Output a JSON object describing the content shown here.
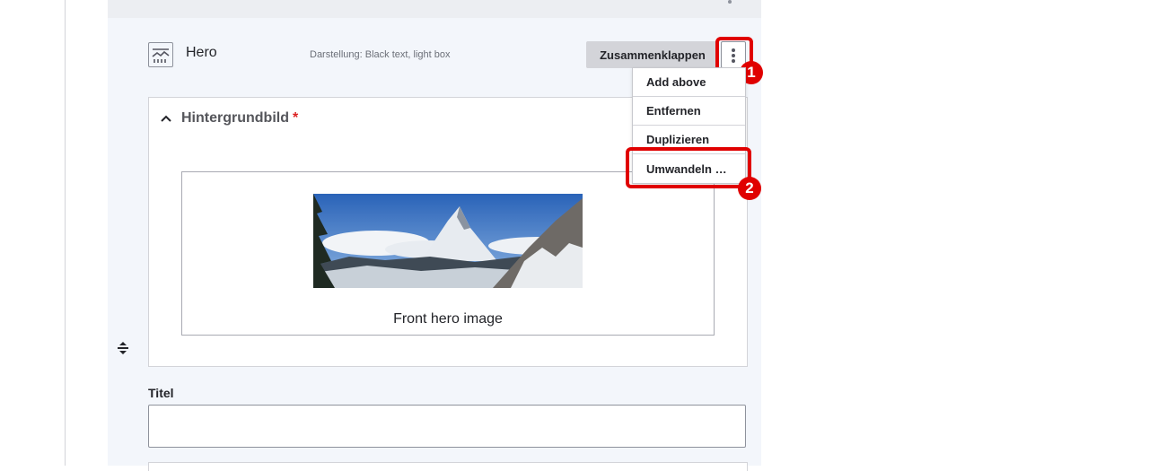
{
  "paragraph": {
    "title": "Hero",
    "summary": "Darstellung: Black text, light box",
    "collapse_label": "Zusammenklappen",
    "icon": "hero-paragraph-icon"
  },
  "actions_menu": {
    "icon": "kebab-menu-icon",
    "items": [
      {
        "label": "Add above"
      },
      {
        "label": "Entfernen"
      },
      {
        "label": "Duplizieren"
      },
      {
        "label": "Umwandeln …"
      }
    ]
  },
  "callouts": {
    "first": "1",
    "second": "2"
  },
  "background_field": {
    "label": "Hintergrundbild",
    "required_mark": "*",
    "media_caption": "Front hero image"
  },
  "title_field": {
    "label": "Titel",
    "value": ""
  },
  "colors": {
    "highlight": "#e00000",
    "required": "#dc2323",
    "panel": "#f3f6fb"
  }
}
